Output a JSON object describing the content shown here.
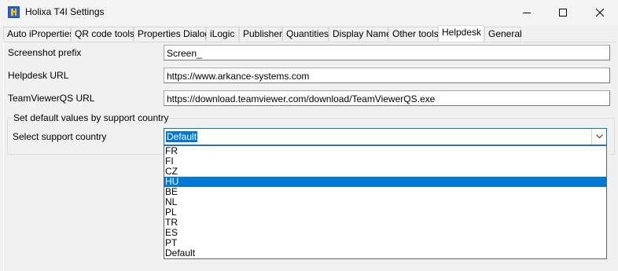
{
  "window": {
    "title": "Holixa T4I Settings",
    "controls": [
      "minimize",
      "maximize",
      "close"
    ]
  },
  "tabs": [
    {
      "label": "Auto iProperties"
    },
    {
      "label": "QR code tools"
    },
    {
      "label": "Properties Dialog"
    },
    {
      "label": "iLogic"
    },
    {
      "label": "Publisher"
    },
    {
      "label": "Quantities"
    },
    {
      "label": "Display Name"
    },
    {
      "label": "Other tools"
    },
    {
      "label": "Helpdesk",
      "active": true
    },
    {
      "label": "General"
    }
  ],
  "helpdesk": {
    "screenshot_prefix": {
      "label": "Screenshot prefix",
      "value": "Screen_"
    },
    "helpdesk_url": {
      "label": "Helpdesk URL",
      "value": "https://www.arkance-systems.com"
    },
    "teamviewer_url": {
      "label": "TeamViewerQS URL",
      "value": "https://download.teamviewer.com/download/TeamViewerQS.exe"
    }
  },
  "support_group": {
    "title": "Set default values by support country",
    "country_label": "Select support country",
    "selected_value": "Default",
    "options": [
      "FR",
      "FI",
      "CZ",
      "HU",
      "BE",
      "NL",
      "PL",
      "TR",
      "ES",
      "PT",
      "Default"
    ],
    "highlighted_option": "HU"
  },
  "colors": {
    "selection": "#0078d7",
    "window_bg": "#f0f0f0",
    "tab_active_bg": "#ffffff"
  },
  "icons": {
    "app": "holixa-app-icon",
    "minimize": "minimize-icon",
    "maximize": "maximize-icon",
    "close": "close-icon",
    "dropdown": "chevron-down-icon"
  }
}
